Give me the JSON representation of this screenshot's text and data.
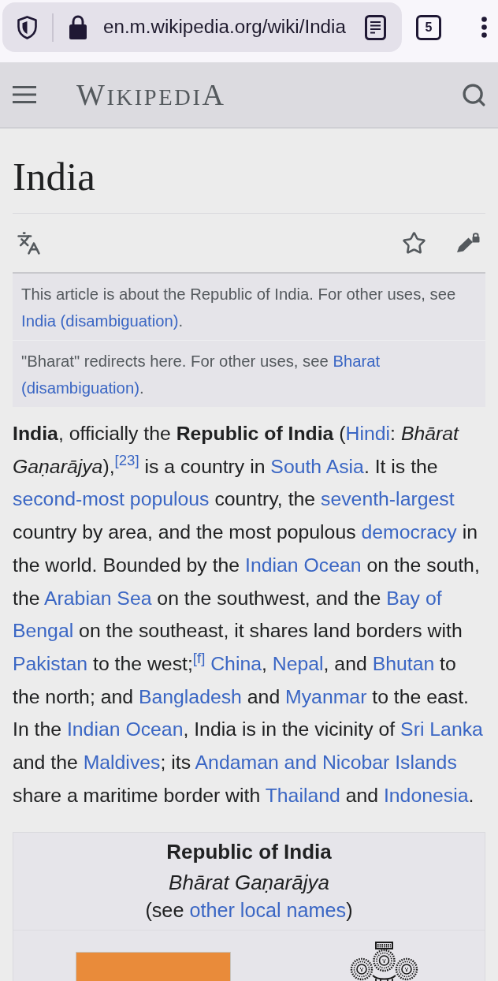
{
  "browser": {
    "url": "en.m.wikipedia.org/wiki/India",
    "tab_count": "5"
  },
  "header": {
    "wordmark": "WIKIPEDIA"
  },
  "article": {
    "title": "India"
  },
  "hatnotes": [
    {
      "segments": [
        {
          "kind": "text",
          "text": "This article is about the Republic of India. For other uses, see "
        },
        {
          "kind": "link",
          "parts": [
            "India (disambiguation)"
          ]
        },
        {
          "kind": "text",
          "text": "."
        }
      ]
    },
    {
      "segments": [
        {
          "kind": "text",
          "text": "\"Bharat\" redirects here. For other uses, see "
        },
        {
          "kind": "link",
          "parts": [
            "Bharat",
            "(disambiguation)"
          ]
        },
        {
          "kind": "text",
          "text": "."
        }
      ]
    }
  ],
  "lead": {
    "segments": [
      {
        "kind": "text",
        "text": "**India**, officially the **Republic of India** ("
      },
      {
        "kind": "link",
        "parts": [
          "Hindi"
        ]
      },
      {
        "kind": "text",
        "text": ": *Bhārat Gaṇarājya*),$^{[23]}$ is a country in "
      },
      {
        "kind": "link",
        "parts": [
          "South Asia"
        ]
      },
      {
        "kind": "text",
        "text": ". It is the "
      },
      {
        "kind": "link",
        "parts": [
          "second-most populous"
        ]
      },
      {
        "kind": "text",
        "text": " country, the "
      },
      {
        "kind": "link",
        "parts": [
          "seventh-largest"
        ]
      },
      {
        "kind": "text",
        "text": " country by area, and the most populous "
      },
      {
        "kind": "link",
        "parts": [
          "democracy"
        ]
      },
      {
        "kind": "text",
        "text": " in the world. Bounded by the "
      },
      {
        "kind": "link",
        "parts": [
          "Indian Ocean"
        ]
      },
      {
        "kind": "text",
        "text": " on the south, the "
      },
      {
        "kind": "link",
        "parts": [
          "Arabian Sea"
        ]
      },
      {
        "kind": "text",
        "text": " on the southwest, and the "
      },
      {
        "kind": "link",
        "parts": [
          "Bay of",
          "Bengal"
        ]
      },
      {
        "kind": "text",
        "text": " on the southeast, it shares land borders with "
      },
      {
        "kind": "link",
        "parts": [
          "Pakistan"
        ]
      },
      {
        "kind": "text",
        "text": " to the west;$^{[f]}$ "
      },
      {
        "kind": "link",
        "parts": [
          "China"
        ]
      },
      {
        "kind": "text",
        "text": ", "
      },
      {
        "kind": "link",
        "parts": [
          "Nepal"
        ]
      },
      {
        "kind": "text",
        "text": ", and "
      },
      {
        "kind": "link",
        "parts": [
          "Bhutan"
        ]
      },
      {
        "kind": "text",
        "text": " to the north; and "
      },
      {
        "kind": "link",
        "parts": [
          "Bangladesh"
        ]
      },
      {
        "kind": "text",
        "text": " and "
      },
      {
        "kind": "link",
        "parts": [
          "Myanmar"
        ]
      },
      {
        "kind": "text",
        "text": " to the east. In the "
      },
      {
        "kind": "link",
        "parts": [
          "Indian Ocean"
        ]
      },
      {
        "kind": "text",
        "text": ", India is in the vicinity of "
      },
      {
        "kind": "link",
        "parts": [
          "Sri Lanka"
        ]
      },
      {
        "kind": "text",
        "text": " and the "
      },
      {
        "kind": "link",
        "parts": [
          "Maldives"
        ]
      },
      {
        "kind": "text",
        "text": "; its "
      },
      {
        "kind": "link",
        "parts": [
          "Andaman and Nicobar Islands"
        ]
      },
      {
        "kind": "text",
        "text": " share a maritime border with "
      },
      {
        "kind": "link",
        "parts": [
          "Thailand"
        ]
      },
      {
        "kind": "text",
        "text": " and "
      },
      {
        "kind": "link",
        "parts": [
          "Indonesia"
        ]
      },
      {
        "kind": "text",
        "text": "."
      }
    ]
  },
  "infobox": {
    "title": "Republic of India",
    "native_name": "Bhārat Gaṇarājya",
    "note": [
      {
        "kind": "text",
        "text": "(see "
      },
      {
        "kind": "link",
        "parts": [
          "other local names"
        ]
      },
      {
        "kind": "text",
        "text": ")"
      }
    ]
  }
}
